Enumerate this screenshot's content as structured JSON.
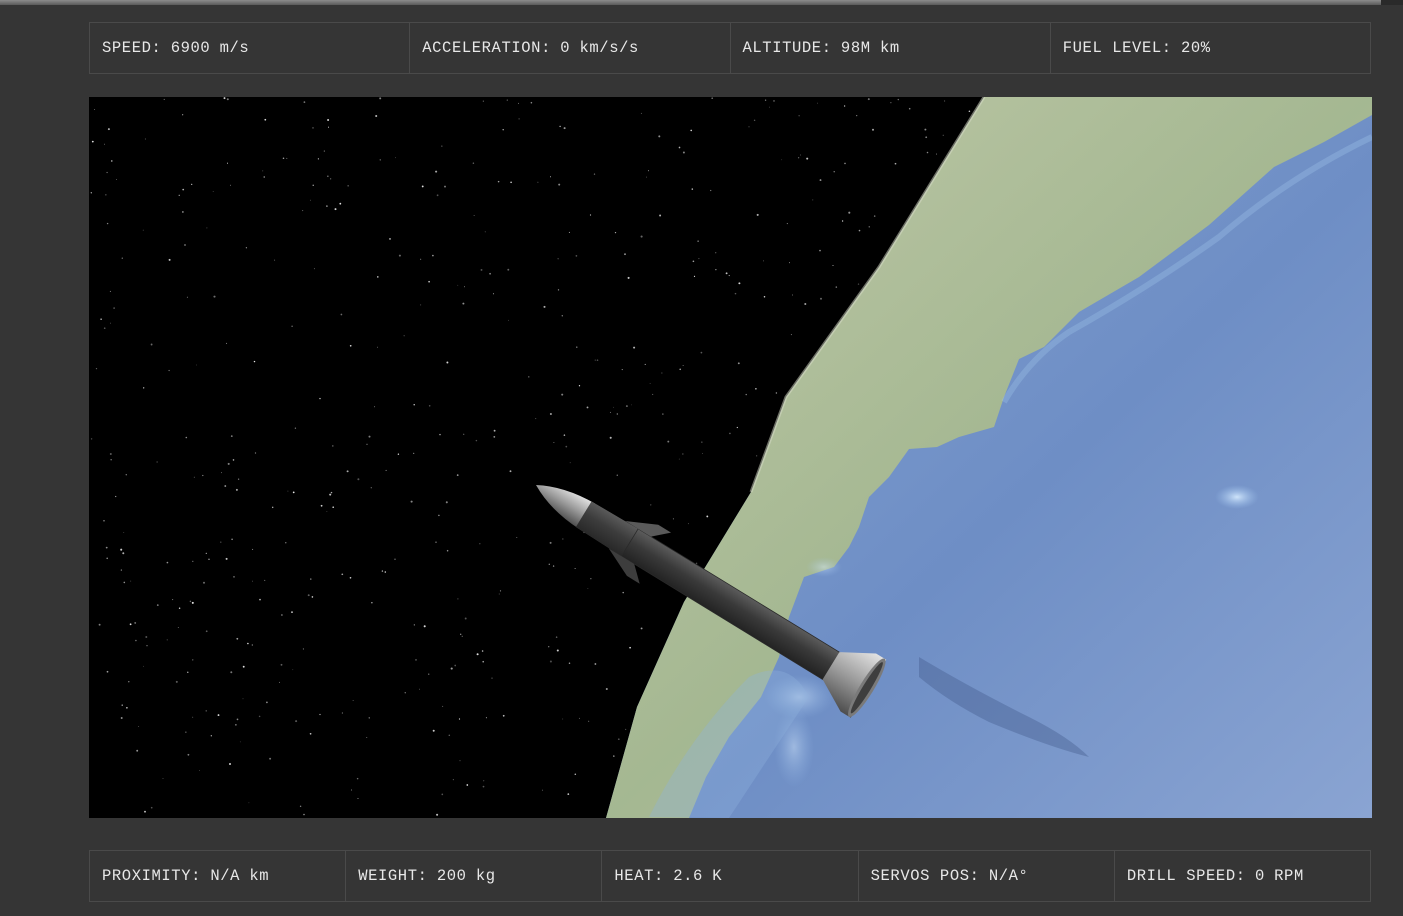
{
  "telemetry_top": [
    {
      "label": "SPEED:",
      "value": "6900",
      "unit": "m/s"
    },
    {
      "label": "ACCELERATION:",
      "value": "0",
      "unit": "km/s/s"
    },
    {
      "label": "ALTITUDE:",
      "value": "98M",
      "unit": "km"
    },
    {
      "label": "FUEL LEVEL:",
      "value": "20%",
      "unit": ""
    }
  ],
  "telemetry_bottom": [
    {
      "label": "PROXIMITY:",
      "value": "N/A",
      "unit": "km"
    },
    {
      "label": "WEIGHT:",
      "value": "200",
      "unit": "kg"
    },
    {
      "label": "HEAT:",
      "value": "2.6",
      "unit": "K"
    },
    {
      "label": "SERVOS POS:",
      "value": "N/A°",
      "unit": ""
    },
    {
      "label": "DRILL SPEED:",
      "value": "0",
      "unit": "RPM"
    }
  ],
  "scene": {
    "background": "#000000",
    "planet": "earth",
    "craft": "rocket",
    "colors": {
      "ocean": "#7d9ccb",
      "land": "#b7c39a",
      "rocket_body": "#3f3f3f",
      "rocket_metal": "#b5b5b5"
    }
  }
}
